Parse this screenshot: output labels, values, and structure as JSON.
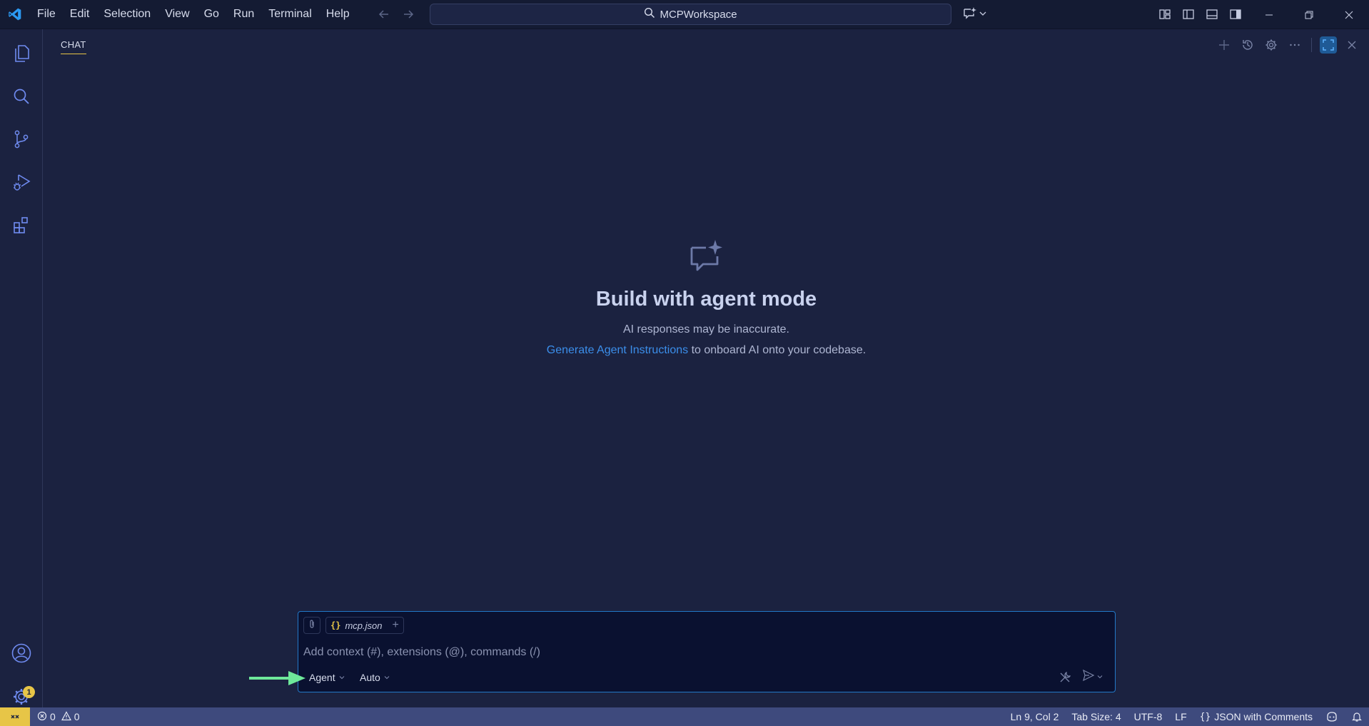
{
  "titlebar": {
    "menu": [
      "File",
      "Edit",
      "Selection",
      "View",
      "Go",
      "Run",
      "Terminal",
      "Help"
    ],
    "search_text": "MCPWorkspace"
  },
  "activitybar": {
    "items": [
      "explorer-icon",
      "search-icon",
      "source-control-icon",
      "run-debug-icon",
      "extensions-icon"
    ],
    "bottom": [
      "accounts-icon",
      "manage-gear-icon"
    ],
    "manage_badge": "1"
  },
  "chat": {
    "tab_label": "CHAT",
    "welcome_title": "Build with agent mode",
    "welcome_subtitle": "AI responses may be inaccurate.",
    "instructions_link": "Generate Agent Instructions",
    "instructions_rest": " to onboard AI onto your codebase.",
    "context_file": "mcp.json",
    "input_placeholder": "Add context (#), extensions (@), commands (/)",
    "mode": "Agent",
    "model": "Auto"
  },
  "statusbar": {
    "errors": "0",
    "warnings": "0",
    "cursor": "Ln 9, Col 2",
    "tab_size": "Tab Size: 4",
    "encoding": "UTF-8",
    "eol": "LF",
    "language": "JSON with Comments"
  },
  "colors": {
    "accent": "#e7c547",
    "link": "#3b8eea",
    "statusbar": "#3e4a7d",
    "annotation_arrow": "#6ee89a"
  }
}
